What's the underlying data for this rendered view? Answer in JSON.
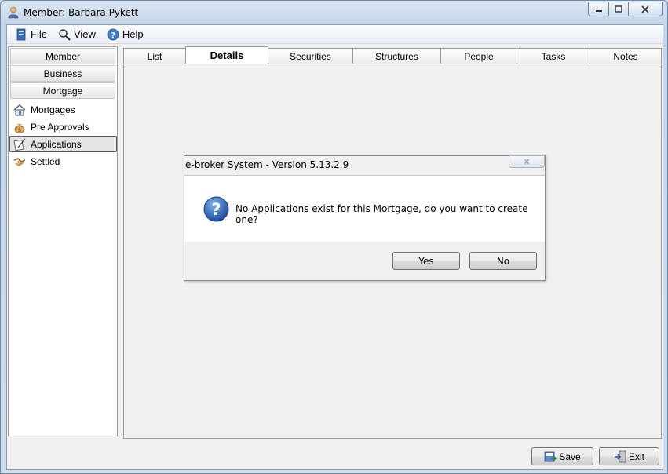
{
  "window": {
    "title": "Member: Barbara Pykett",
    "icon": "user-icon"
  },
  "menu": {
    "items": [
      {
        "label": "File",
        "icon": "file-icon"
      },
      {
        "label": "View",
        "icon": "magnifier-icon"
      },
      {
        "label": "Help",
        "icon": "help-icon"
      }
    ]
  },
  "sidebar": {
    "categories": [
      "Member",
      "Business",
      "Mortgage"
    ],
    "items": [
      {
        "label": "Mortgages",
        "icon": "house-icon"
      },
      {
        "label": "Pre Approvals",
        "icon": "money-bag-icon"
      },
      {
        "label": "Applications",
        "icon": "application-icon",
        "selected": true
      },
      {
        "label": "Settled",
        "icon": "handshake-icon"
      }
    ]
  },
  "tabs": [
    {
      "label": "List"
    },
    {
      "label": "Details",
      "active": true
    },
    {
      "label": "Securities"
    },
    {
      "label": "Structures"
    },
    {
      "label": "People"
    },
    {
      "label": "Tasks"
    },
    {
      "label": "Notes"
    }
  ],
  "dialog": {
    "title": "e-broker System - Version 5.13.2.9",
    "close_label": "✕",
    "message": "No Applications exist for this Mortgage, do you want to create one?",
    "icon": "question-icon",
    "yes_label": "Yes",
    "no_label": "No"
  },
  "footer": {
    "save_label": "Save",
    "exit_label": "Exit"
  }
}
